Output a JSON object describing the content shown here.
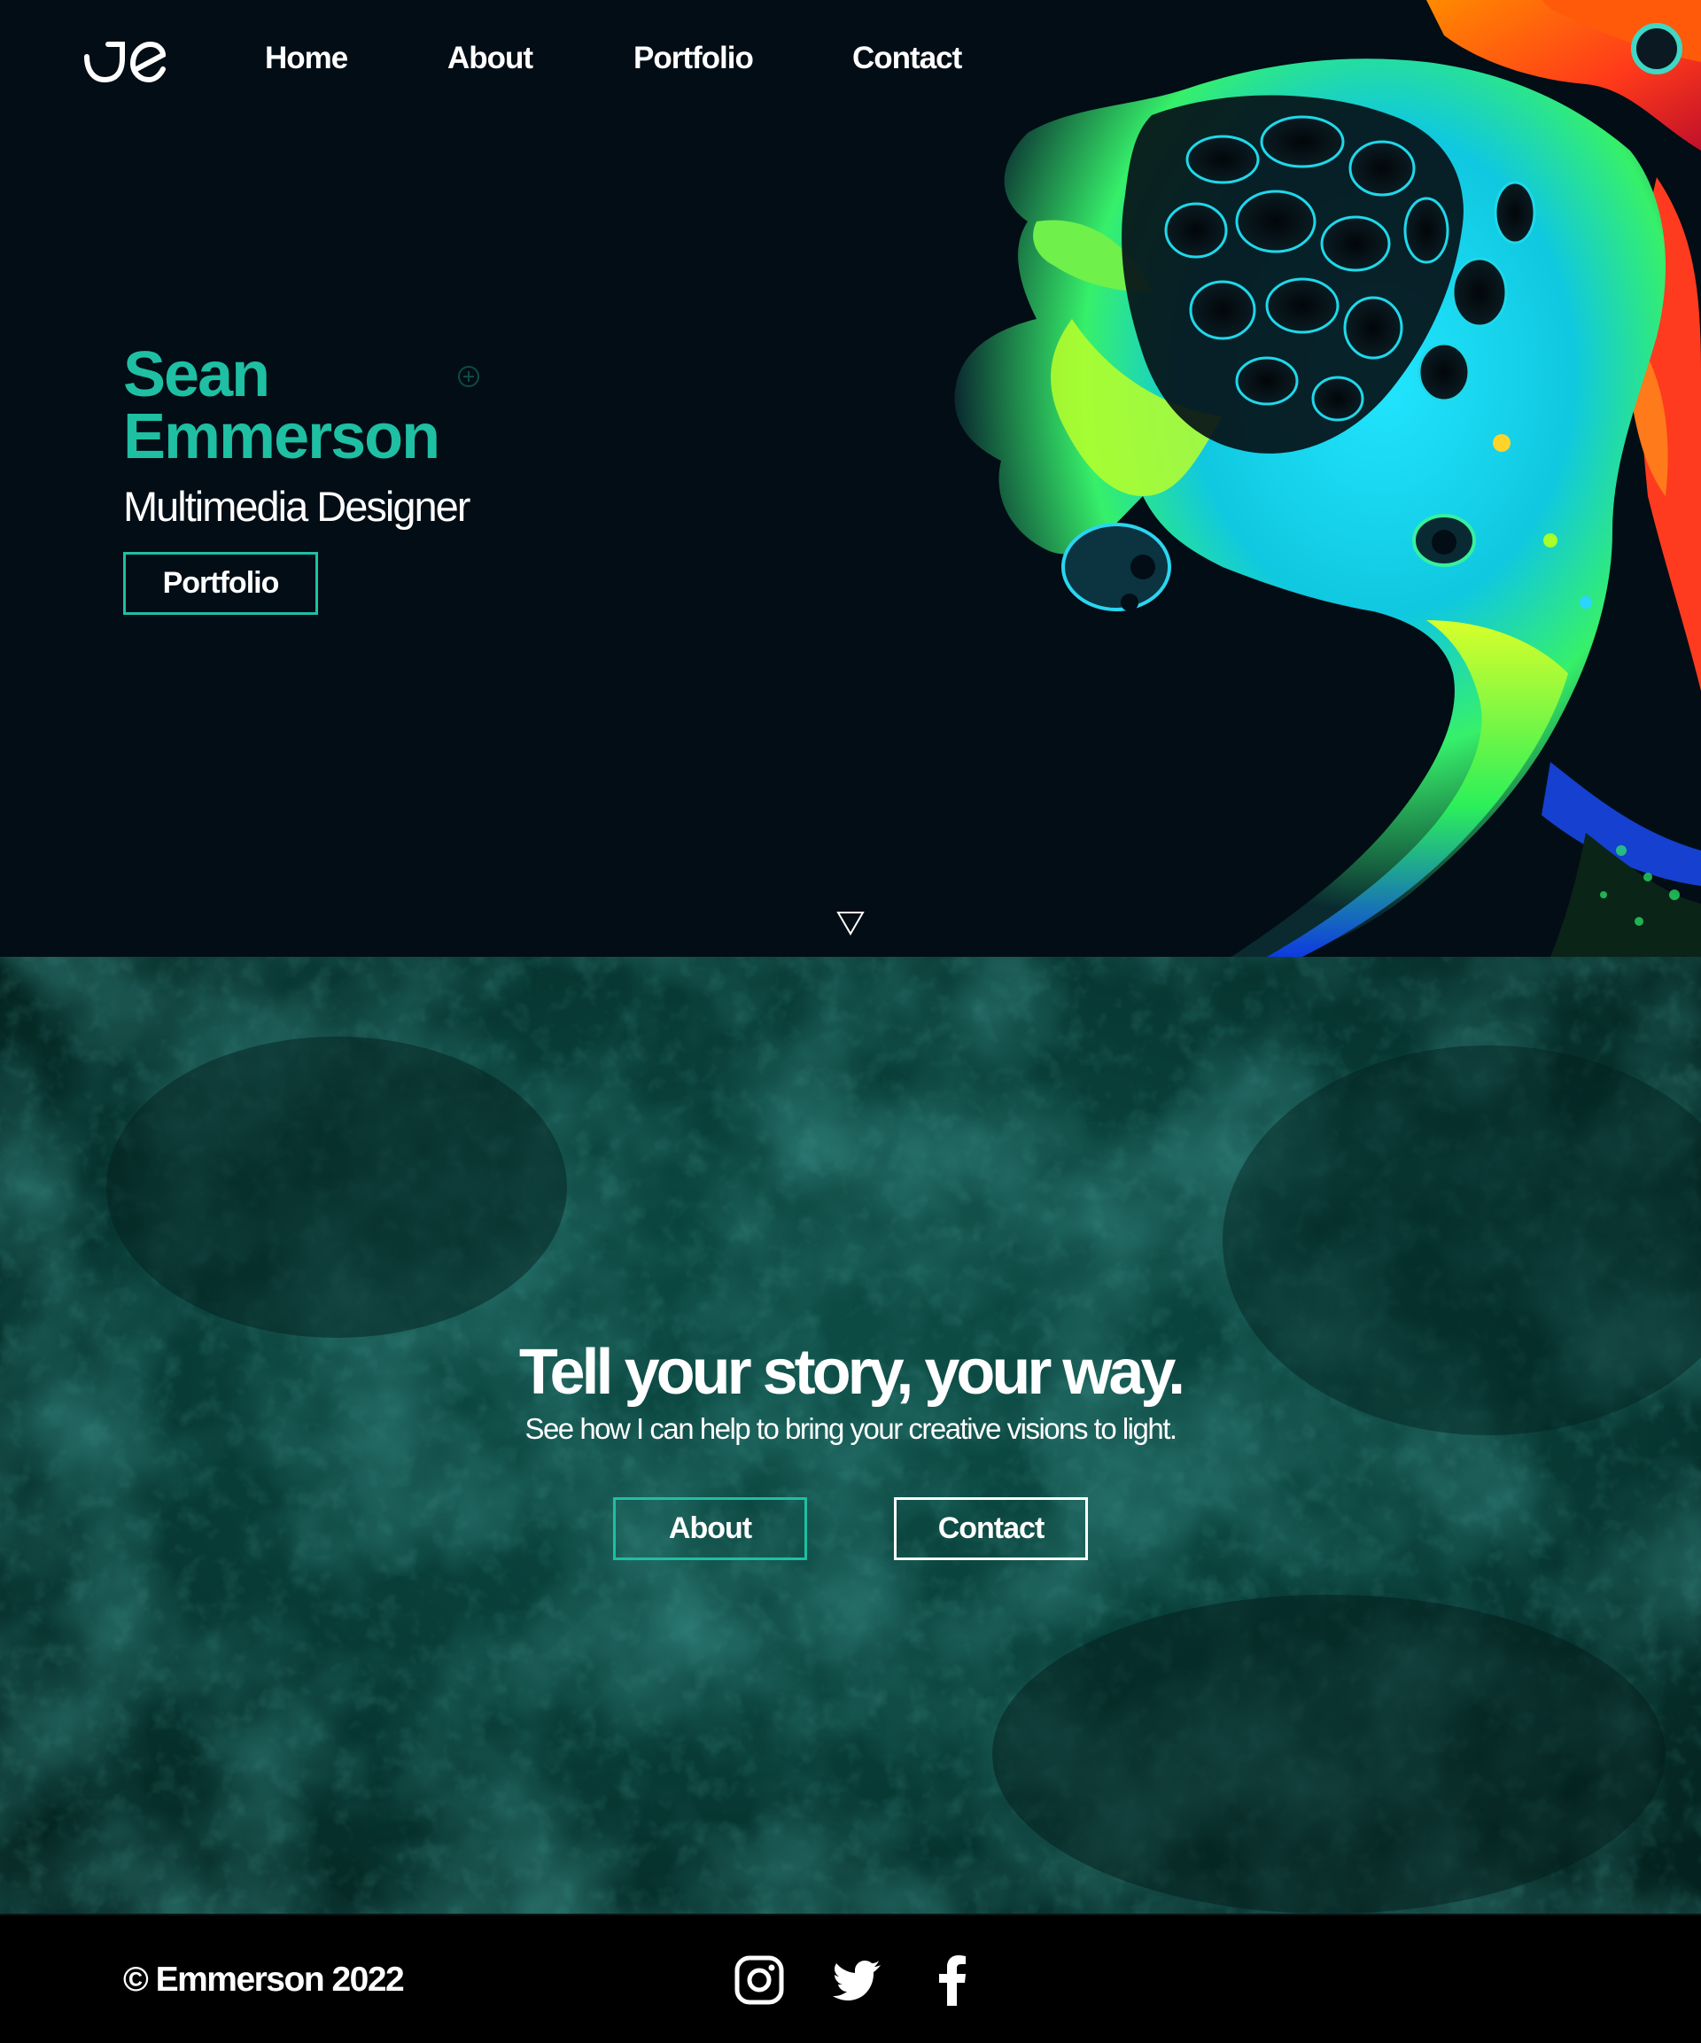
{
  "nav": {
    "logo": "JE",
    "links": [
      {
        "label": "Home"
      },
      {
        "label": "About"
      },
      {
        "label": "Portfolio"
      },
      {
        "label": "Contact"
      }
    ]
  },
  "hero": {
    "first_name": "Sean",
    "last_name": "Emmerson",
    "title": "Multimedia Designer",
    "portfolio_button": "Portfolio",
    "scroll_icon": "triangle-down-icon"
  },
  "story": {
    "heading": "Tell your story, your way.",
    "subheading": "See how I can help to bring your creative visions to light.",
    "about_button": "About",
    "contact_button": "Contact"
  },
  "footer": {
    "copyright": "© Emmerson 2022",
    "social": [
      {
        "icon": "instagram-icon"
      },
      {
        "icon": "twitter-icon"
      },
      {
        "icon": "facebook-icon"
      }
    ]
  },
  "colors": {
    "accent": "#1fbfa3",
    "hero_bg": "#030d15",
    "story_bg": "#083b36",
    "footer_bg": "#000000",
    "text": "#ffffff"
  }
}
